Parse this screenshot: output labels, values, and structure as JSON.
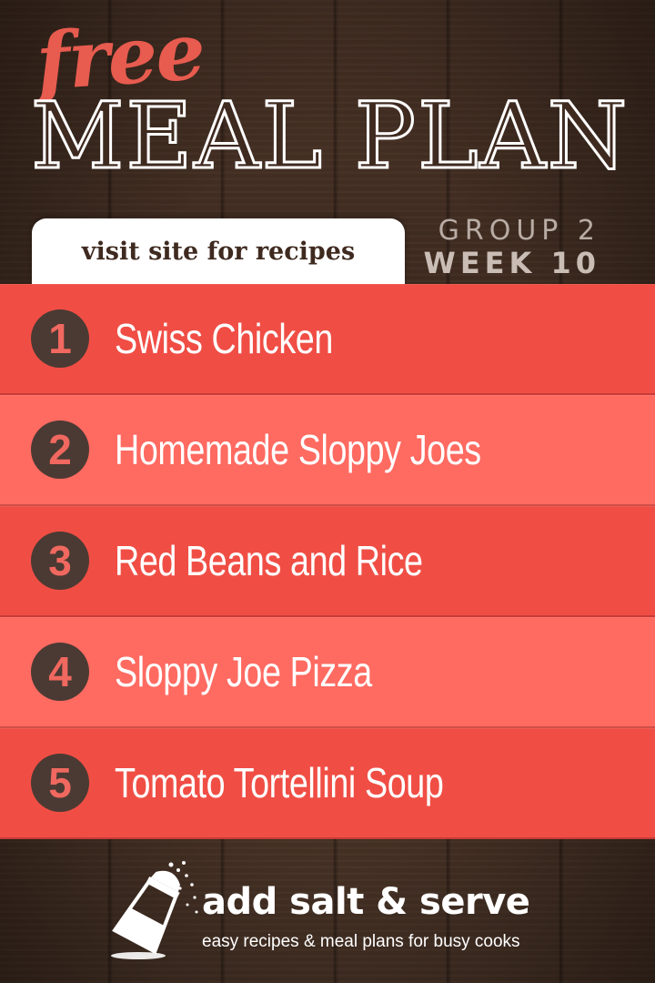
{
  "header": {
    "free": "free",
    "title": "MEAL PLAN",
    "visit_tab": "visit site for recipes",
    "group": "GROUP 2",
    "week": "WEEK 10"
  },
  "meals": [
    {
      "number": "1",
      "name": "Swiss Chicken"
    },
    {
      "number": "2",
      "name": "Homemade Sloppy Joes"
    },
    {
      "number": "3",
      "name": "Red Beans and Rice"
    },
    {
      "number": "4",
      "name": "Sloppy Joe Pizza"
    },
    {
      "number": "5",
      "name": "Tomato Tortellini Soup"
    }
  ],
  "footer": {
    "brand": "add salt & serve",
    "tagline": "easy recipes & meal plans for busy cooks",
    "icon": "salt-shaker-icon"
  },
  "colors": {
    "row_dark": "#f04e45",
    "row_light": "#ff6a61",
    "free_red": "#e85b4f",
    "badge": "#4a3a33",
    "wood": "#3b281e"
  }
}
